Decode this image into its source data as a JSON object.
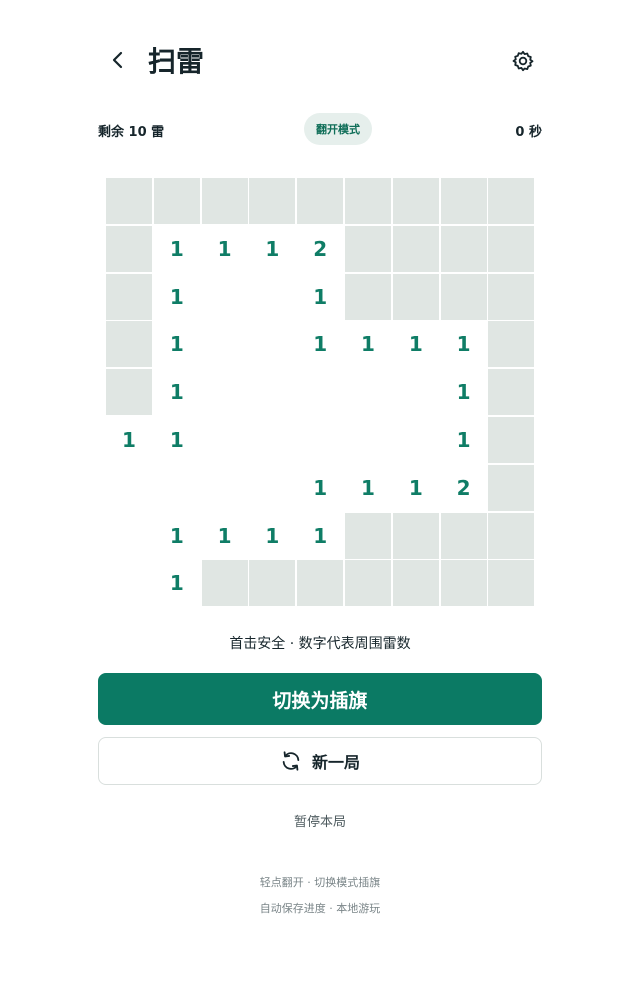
{
  "header": {
    "title": "扫雷",
    "back_icon": "chevron-left-icon",
    "settings_icon": "gear-icon"
  },
  "status": {
    "remaining": "剩余 10 雷",
    "mode": "翻开模式",
    "timer": "0 秒"
  },
  "board": {
    "rows": 9,
    "cols": 9,
    "grid": [
      [
        "#",
        "#",
        "#",
        "#",
        "#",
        "#",
        "#",
        "#",
        "#"
      ],
      [
        "#",
        "1",
        "1",
        "1",
        "2",
        "#",
        "#",
        "#",
        "#"
      ],
      [
        "#",
        "1",
        "",
        "",
        "1",
        "#",
        "#",
        "#",
        "#"
      ],
      [
        "#",
        "1",
        "",
        "",
        "1",
        "1",
        "1",
        "1",
        "#"
      ],
      [
        "#",
        "1",
        "",
        "",
        "",
        "",
        "",
        "1",
        "#"
      ],
      [
        "1",
        "1",
        "",
        "",
        "",
        "",
        "",
        "1",
        "#"
      ],
      [
        "",
        "",
        "",
        "",
        "1",
        "1",
        "1",
        "2",
        "#"
      ],
      [
        "",
        "1",
        "1",
        "1",
        "1",
        "#",
        "#",
        "#",
        "#"
      ],
      [
        "",
        "1",
        "#",
        "#",
        "#",
        "#",
        "#",
        "#",
        "#"
      ]
    ],
    "colors": {
      "hidden": "#e0e6e3",
      "open": "#ffffff",
      "number": "#0f7d66"
    }
  },
  "hint": "首击安全 · 数字代表周围雷数",
  "actions": {
    "toggle_label": "切换为插旗",
    "new_game_label": "新一局",
    "new_game_icon": "refresh-icon",
    "pause_label": "暂停本局"
  },
  "footer": {
    "line1": "轻点翻开 · 切换模式插旗",
    "line2": "自动保存进度 · 本地游玩"
  },
  "theme": {
    "accent": "#0b7a64",
    "pill_bg": "#e6efec"
  }
}
